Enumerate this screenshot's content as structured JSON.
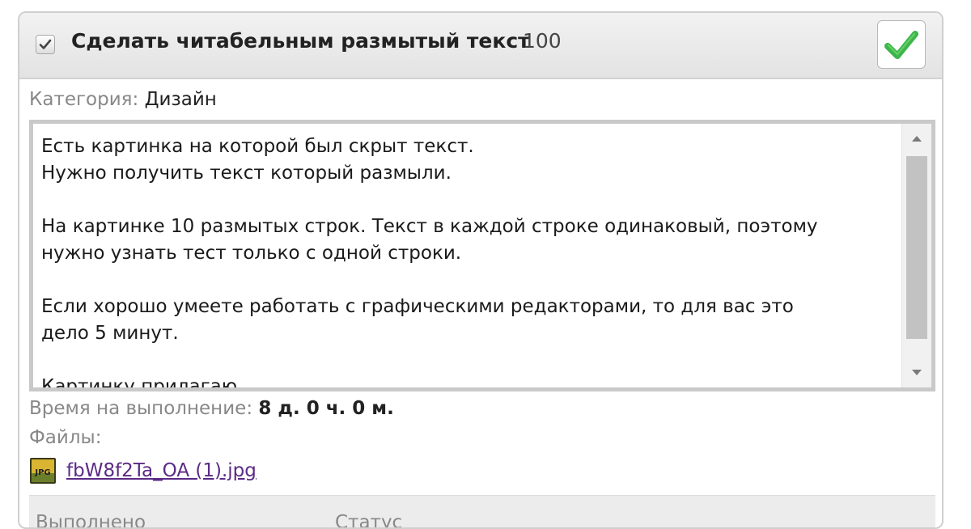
{
  "task": {
    "title": "Сделать читабельным размытый текст",
    "count": "100",
    "category_label": "Категория:",
    "category_value": "Дизайн",
    "description": "Есть картинка на которой был скрыт текст.\nНужно получить текст который размыли.\n\nНа картинке 10 размытых строк. Текст в каждой строке одинаковый, поэтому\nнужно узнать тест только с одной строки.\n\nЕсли хорошо умеете работать с графическими редакторами, то для вас это\nдело 5 минут.\n\nКартинку прилагаю.",
    "deadline_label": "Время на выполнение:",
    "deadline_value": "8 д. 0 ч. 0 м.",
    "files_label": "Файлы:",
    "file_name": "fbW8f2Ta_OA (1).jpg",
    "file_icon_text": "JPG",
    "footer_partial_1": "Выполнено",
    "footer_partial_2": "Статус"
  },
  "icons": {
    "checkbox": "checkmark-icon",
    "approve": "green-check-icon",
    "file": "jpg-file-icon"
  },
  "colors": {
    "approve_green": "#3cb54a",
    "link_purple": "#5b2a86",
    "meta_grey": "#888888"
  }
}
